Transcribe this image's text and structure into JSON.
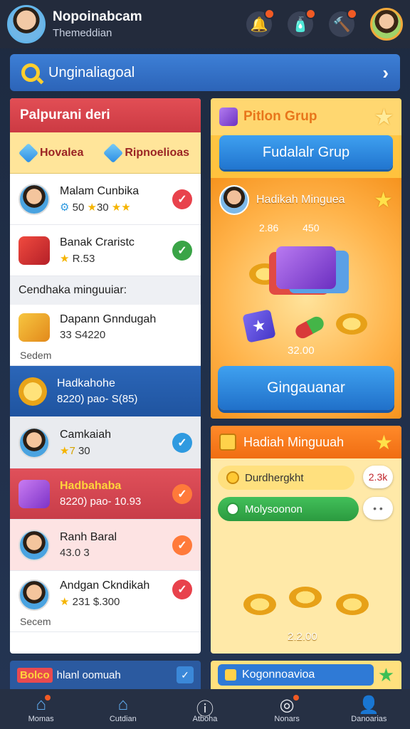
{
  "header": {
    "title": "Nopoinabcam",
    "subtitle": "Themeddian",
    "icons": [
      "bell-icon",
      "bottle-icon",
      "hammer-icon"
    ]
  },
  "search": {
    "label": "Unginaliagoal"
  },
  "left": {
    "title": "Palpurani deri",
    "tabs": [
      "Hovalea",
      "Ripnoelioas"
    ],
    "rows": [
      {
        "name": "Malam Cunbika",
        "value": "50",
        "value2": "30"
      },
      {
        "name": "Banak Craristc",
        "value": "R.53"
      }
    ],
    "section_label": "Cendhaka minguuiar:",
    "rows2": [
      {
        "name": "Dapann Gnndugah",
        "value": "33 S4220",
        "sub": "Sedem"
      },
      {
        "name": "Hadkahohe",
        "value": "8220) pao- S(85)"
      },
      {
        "name": "Camkaiah",
        "value": "30"
      },
      {
        "name": "Hadbahaba",
        "value": "8220) pao- 10.93"
      },
      {
        "name": "Ranh Baral",
        "value": "43.0 3"
      },
      {
        "name": "Andgan Ckndikah",
        "value": "231 $.300",
        "sub": "Secem"
      }
    ],
    "bottom_tag": "Bolco",
    "bottom_text": "hlanl oomuah"
  },
  "right": {
    "title": "Pitlon Grup",
    "button": "Fudalalr Grup",
    "reward_title": "Hadikah Minguea",
    "reward_nums": "2.86 450",
    "reward_amount": "32.00",
    "claim": "Gingauanar",
    "weekly_title": "Hadiah Minguuah",
    "pill1": "Durdhergkht",
    "badge1": "2.3k",
    "pill2": "Molysoonon",
    "badge2": "• •",
    "weekly_amount": "2.2.00",
    "bottom_text": "Kogonnoavioa"
  },
  "nav": [
    {
      "label": "Momas",
      "icon": "home-icon"
    },
    {
      "label": "Cutdian",
      "icon": "house-icon"
    },
    {
      "label": "Atboha",
      "icon": "info-icon"
    },
    {
      "label": "Nonars",
      "icon": "chat-icon"
    },
    {
      "label": "Danoarias",
      "icon": "profile-icon"
    }
  ]
}
